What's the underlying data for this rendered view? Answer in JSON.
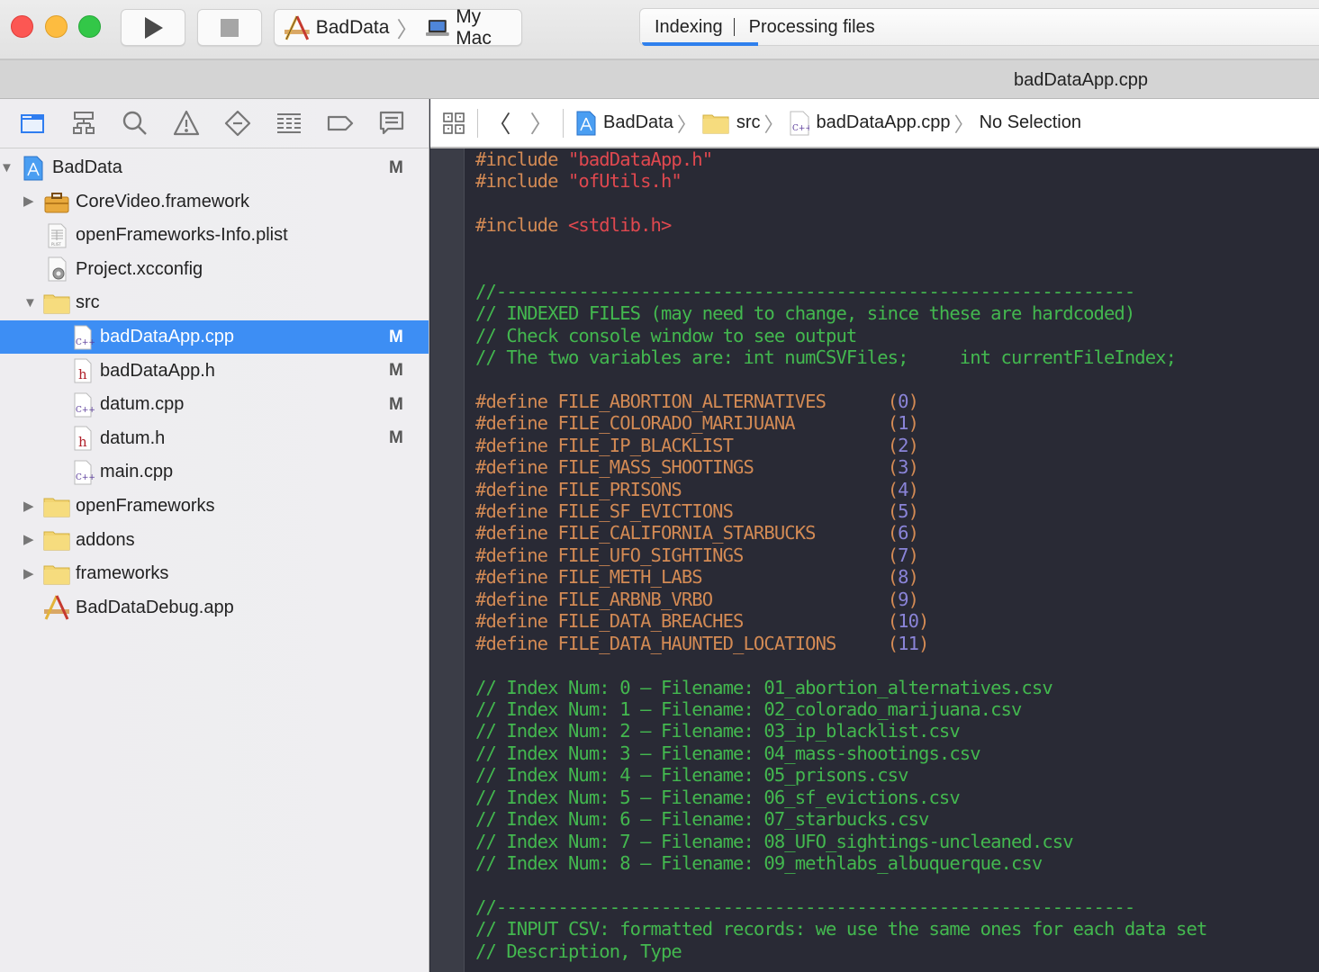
{
  "toolbar": {
    "scheme": {
      "target": "BadData",
      "device": "My Mac"
    },
    "activity": {
      "status": "Indexing",
      "detail": "Processing files",
      "progress": 0.17
    }
  },
  "tabbar": {
    "title": "badDataApp.cpp"
  },
  "navigator": {
    "icons": [
      "folder-icon",
      "hierarchy-icon",
      "search-icon",
      "warning-icon",
      "breakpoint-diamond-icon",
      "list-icon",
      "tag-icon",
      "comment-icon"
    ],
    "items": [
      {
        "label": "BadData",
        "badge": "M",
        "icon": "project-icon",
        "level": 0,
        "disclosure": "open"
      },
      {
        "label": "CoreVideo.framework",
        "badge": "",
        "icon": "framework-icon",
        "level": 1,
        "disclosure": "closed"
      },
      {
        "label": "openFrameworks-Info.plist",
        "badge": "",
        "icon": "plist-file-icon",
        "level": 1,
        "disclosure": "none"
      },
      {
        "label": "Project.xcconfig",
        "badge": "",
        "icon": "xcconfig-file-icon",
        "level": 1,
        "disclosure": "none"
      },
      {
        "label": "src",
        "badge": "",
        "icon": "folder-icon",
        "level": 1,
        "disclosure": "open"
      },
      {
        "label": "badDataApp.cpp",
        "badge": "M",
        "icon": "cpp-file-icon",
        "level": 2,
        "disclosure": "none",
        "selected": true
      },
      {
        "label": "badDataApp.h",
        "badge": "M",
        "icon": "header-file-icon",
        "level": 2,
        "disclosure": "none"
      },
      {
        "label": "datum.cpp",
        "badge": "M",
        "icon": "cpp-file-icon",
        "level": 2,
        "disclosure": "none"
      },
      {
        "label": "datum.h",
        "badge": "M",
        "icon": "header-file-icon",
        "level": 2,
        "disclosure": "none"
      },
      {
        "label": "main.cpp",
        "badge": "",
        "icon": "cpp-file-icon",
        "level": 2,
        "disclosure": "none"
      },
      {
        "label": "openFrameworks",
        "badge": "",
        "icon": "folder-icon",
        "level": 1,
        "disclosure": "closed"
      },
      {
        "label": "addons",
        "badge": "",
        "icon": "folder-icon",
        "level": 1,
        "disclosure": "closed"
      },
      {
        "label": "frameworks",
        "badge": "",
        "icon": "folder-icon",
        "level": 1,
        "disclosure": "closed"
      },
      {
        "label": "BadDataDebug.app",
        "badge": "",
        "icon": "app-icon",
        "level": 1,
        "disclosure": "none"
      }
    ]
  },
  "jumpbar": {
    "crumbs": [
      "BadData",
      "src",
      "badDataApp.cpp",
      "No Selection"
    ]
  },
  "editor": {
    "lines": [
      [
        [
          "pp",
          "#include "
        ],
        [
          "str",
          "\"badDataApp.h\""
        ]
      ],
      [
        [
          "pp",
          "#include "
        ],
        [
          "str",
          "\"ofUtils.h\""
        ]
      ],
      [],
      [
        [
          "pp",
          "#include "
        ],
        [
          "str",
          "<stdlib.h>"
        ]
      ],
      [],
      [],
      [
        [
          "cmt",
          "//--------------------------------------------------------------"
        ]
      ],
      [
        [
          "cmt",
          "// INDEXED FILES (may need to change, since these are hardcoded)"
        ]
      ],
      [
        [
          "cmt",
          "// Check console window to see output"
        ]
      ],
      [
        [
          "cmt",
          "// The two variables are: int numCSVFiles;     int currentFileIndex;"
        ]
      ],
      [],
      [
        [
          "pp",
          "#define FILE_ABORTION_ALTERNATIVES      "
        ],
        [
          "pp",
          "("
        ],
        [
          "num",
          "0"
        ],
        [
          "pp",
          ")"
        ]
      ],
      [
        [
          "pp",
          "#define FILE_COLORADO_MARIJUANA         "
        ],
        [
          "pp",
          "("
        ],
        [
          "num",
          "1"
        ],
        [
          "pp",
          ")"
        ]
      ],
      [
        [
          "pp",
          "#define FILE_IP_BLACKLIST               "
        ],
        [
          "pp",
          "("
        ],
        [
          "num",
          "2"
        ],
        [
          "pp",
          ")"
        ]
      ],
      [
        [
          "pp",
          "#define FILE_MASS_SHOOTINGS             "
        ],
        [
          "pp",
          "("
        ],
        [
          "num",
          "3"
        ],
        [
          "pp",
          ")"
        ]
      ],
      [
        [
          "pp",
          "#define FILE_PRISONS                    "
        ],
        [
          "pp",
          "("
        ],
        [
          "num",
          "4"
        ],
        [
          "pp",
          ")"
        ]
      ],
      [
        [
          "pp",
          "#define FILE_SF_EVICTIONS               "
        ],
        [
          "pp",
          "("
        ],
        [
          "num",
          "5"
        ],
        [
          "pp",
          ")"
        ]
      ],
      [
        [
          "pp",
          "#define FILE_CALIFORNIA_STARBUCKS       "
        ],
        [
          "pp",
          "("
        ],
        [
          "num",
          "6"
        ],
        [
          "pp",
          ")"
        ]
      ],
      [
        [
          "pp",
          "#define FILE_UFO_SIGHTINGS              "
        ],
        [
          "pp",
          "("
        ],
        [
          "num",
          "7"
        ],
        [
          "pp",
          ")"
        ]
      ],
      [
        [
          "pp",
          "#define FILE_METH_LABS                  "
        ],
        [
          "pp",
          "("
        ],
        [
          "num",
          "8"
        ],
        [
          "pp",
          ")"
        ]
      ],
      [
        [
          "pp",
          "#define FILE_ARBNB_VRBO                 "
        ],
        [
          "pp",
          "("
        ],
        [
          "num",
          "9"
        ],
        [
          "pp",
          ")"
        ]
      ],
      [
        [
          "pp",
          "#define FILE_DATA_BREACHES              "
        ],
        [
          "pp",
          "("
        ],
        [
          "num",
          "10"
        ],
        [
          "pp",
          ")"
        ]
      ],
      [
        [
          "pp",
          "#define FILE_DATA_HAUNTED_LOCATIONS     "
        ],
        [
          "pp",
          "("
        ],
        [
          "num",
          "11"
        ],
        [
          "pp",
          ")"
        ]
      ],
      [],
      [
        [
          "cmt",
          "// Index Num: 0 – Filename: 01_abortion_alternatives.csv"
        ]
      ],
      [
        [
          "cmt",
          "// Index Num: 1 – Filename: 02_colorado_marijuana.csv"
        ]
      ],
      [
        [
          "cmt",
          "// Index Num: 2 – Filename: 03_ip_blacklist.csv"
        ]
      ],
      [
        [
          "cmt",
          "// Index Num: 3 – Filename: 04_mass-shootings.csv"
        ]
      ],
      [
        [
          "cmt",
          "// Index Num: 4 – Filename: 05_prisons.csv"
        ]
      ],
      [
        [
          "cmt",
          "// Index Num: 5 – Filename: 06_sf_evictions.csv"
        ]
      ],
      [
        [
          "cmt",
          "// Index Num: 6 – Filename: 07_starbucks.csv"
        ]
      ],
      [
        [
          "cmt",
          "// Index Num: 7 – Filename: 08_UFO_sightings-uncleaned.csv"
        ]
      ],
      [
        [
          "cmt",
          "// Index Num: 8 – Filename: 09_methlabs_albuquerque.csv"
        ]
      ],
      [],
      [
        [
          "cmt",
          "//--------------------------------------------------------------"
        ]
      ],
      [
        [
          "cmt",
          "// INPUT CSV: formatted records: we use the same ones for each data set"
        ]
      ],
      [
        [
          "cmt",
          "// Description, Type"
        ]
      ]
    ]
  },
  "colors": {
    "accent": "#3d8ef4",
    "progress": "#2f80ed",
    "preprocessor": "#d38a54",
    "string": "#e0484f",
    "comment": "#43b84f",
    "number": "#8a84d8",
    "editor_bg": "#292a35"
  }
}
